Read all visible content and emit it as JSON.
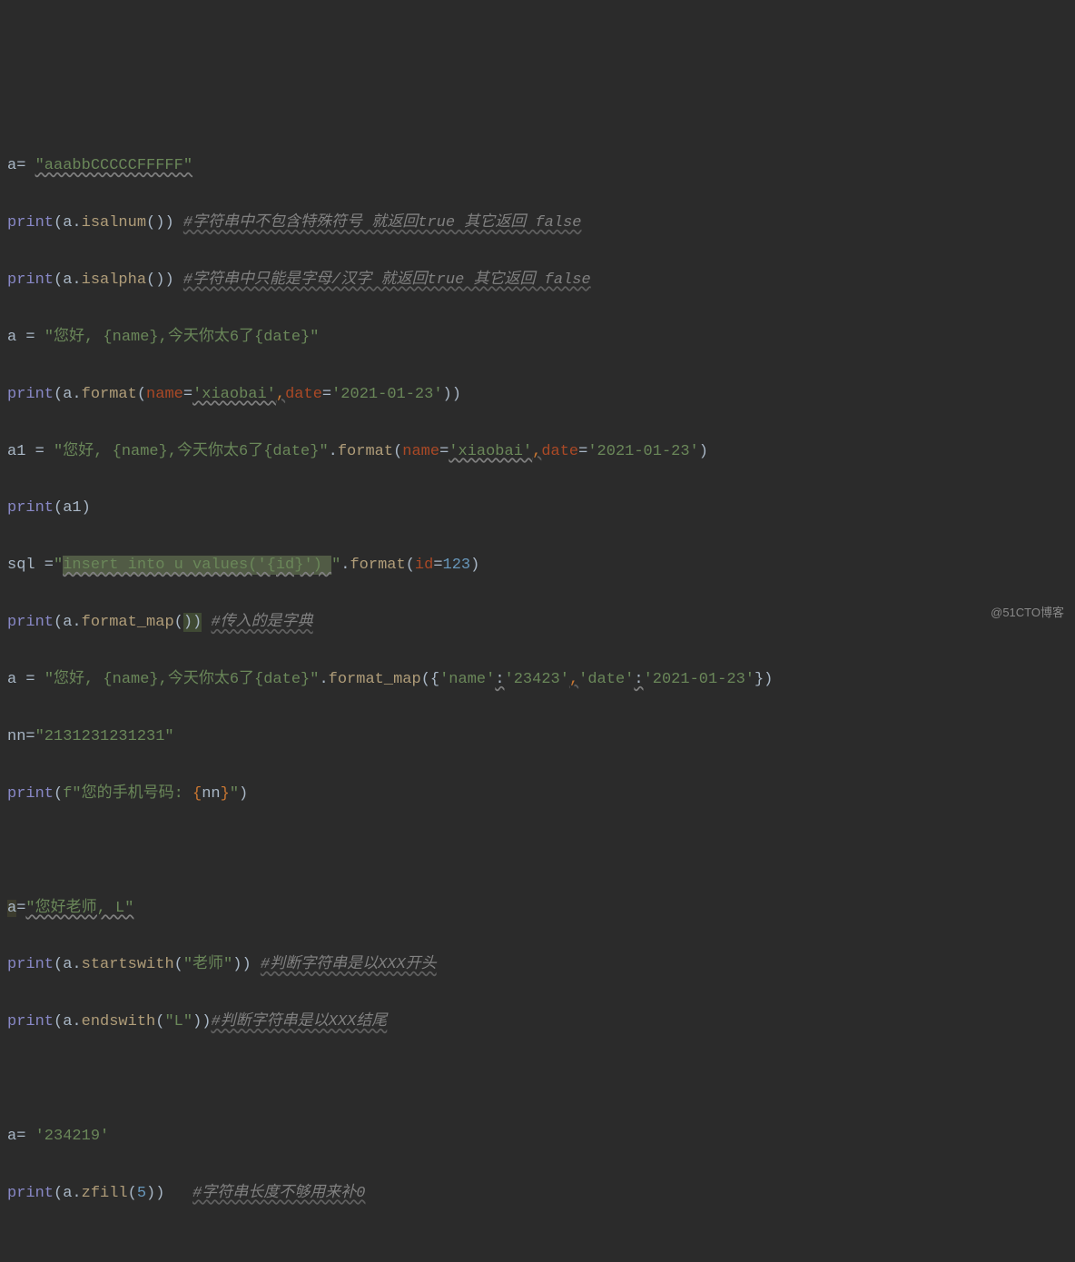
{
  "lines": {
    "l1": {
      "var": "a",
      "op": "= ",
      "str": "\"aaabbCCCCCFFFFF\""
    },
    "l2": {
      "print": "print",
      "var": "a",
      "method": "isalnum",
      "comment": "#字符串中不包含特殊符号 就返回true 其它返回 false"
    },
    "l3": {
      "print": "print",
      "var": "a",
      "method": "isalpha",
      "comment": "#字符串中只能是字母/汉字 就返回true 其它返回 false"
    },
    "l4": {
      "var": "a",
      "op": " = ",
      "str": "\"您好, {name},今天你太6了{date}\""
    },
    "l5": {
      "print": "print",
      "var": "a",
      "method": "format",
      "kw1": "name",
      "v1": "'xiaobai'",
      "kw2": "date",
      "v2": "'2021-01-23'"
    },
    "l6": {
      "var": "a1",
      "op": " = ",
      "str": "\"您好, {name},今天你太6了{date}\"",
      "method": "format",
      "kw1": "name",
      "v1": "'xiaobai'",
      "kw2": "date",
      "v2": "'2021-01-23'"
    },
    "l7": {
      "print": "print",
      "var": "a1"
    },
    "l8": {
      "var": "sql",
      "op": " =",
      "str1": "\"",
      "hlstr": "insert into u values('{id}') ",
      "str2": "\"",
      "method": "format",
      "kw1": "id",
      "v1": "123"
    },
    "l9": {
      "print": "print",
      "var": "a",
      "method": "format_map",
      "comment": "#传入的是字典"
    },
    "l10": {
      "var": "a",
      "op": " = ",
      "str": "\"您好, {name},今天你太6了{date}\"",
      "method": "format_map",
      "k1": "'name'",
      "v1": "'23423'",
      "k2": "'date'",
      "v2": "'2021-01-23'"
    },
    "l11": {
      "var": "nn",
      "op": "=",
      "str": "\"2131231231231\""
    },
    "l12": {
      "print": "print",
      "prefix": "f",
      "str1": "\"您的手机号码: ",
      "brace1": "{",
      "var2": "nn",
      "brace2": "}",
      "str2": "\""
    },
    "l13": {
      "var": "a",
      "op": "=",
      "str": "\"您好老师, L\""
    },
    "l14": {
      "print": "print",
      "var": "a",
      "method": "startswith",
      "arg": "\"老师\"",
      "comment": "#判断字符串是以XXX开头"
    },
    "l15": {
      "print": "print",
      "var": "a",
      "method": "endswith",
      "arg": "\"L\"",
      "comment2": "#判断字符串是以XXX结尾"
    },
    "l16": {
      "var": "a",
      "op": "= ",
      "str": "'234219'"
    },
    "l17": {
      "print": "print",
      "var": "a",
      "method": "zfill",
      "arg": "5",
      "comment": "#字符串长度不够用来补0"
    }
  },
  "watermark": "@51CTO博客"
}
